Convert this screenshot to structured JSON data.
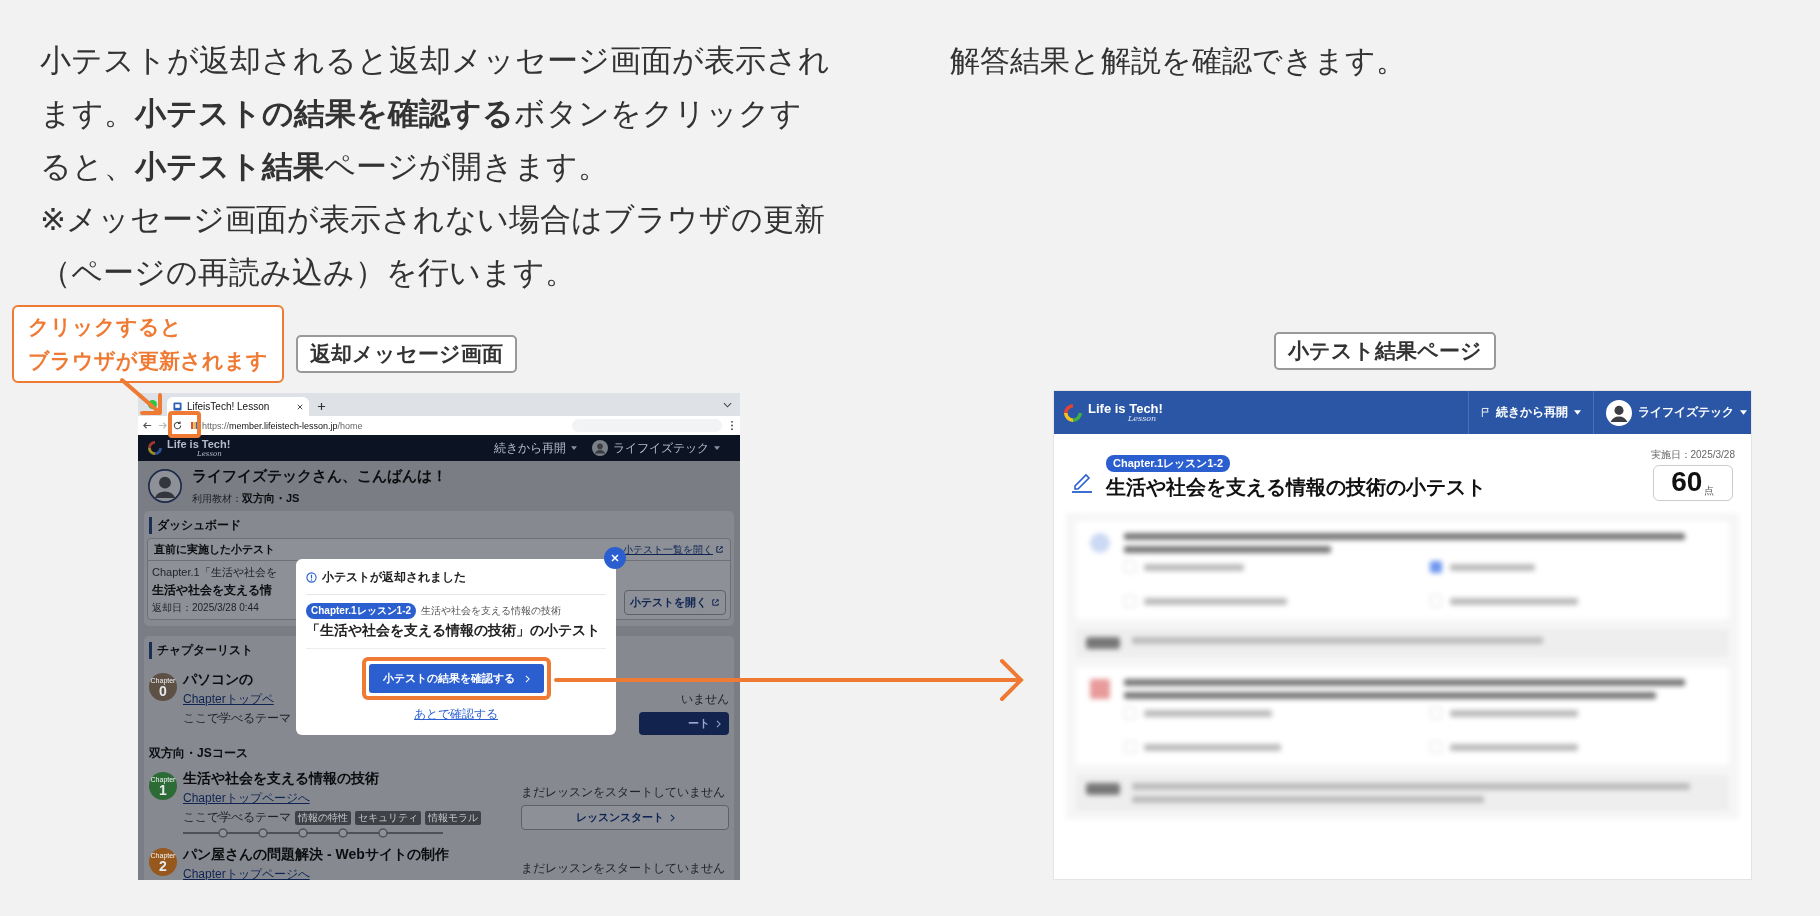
{
  "instructions": {
    "left": [
      "小テストが返却されると返却メッセージ画面が表示されます。**小テストの結果を確認する**ボタンをクリックすると、**小テスト結果**ページが開きます。",
      "※メッセージ画面が表示されない場合はブラウザの更新（ページの再読み込み）を行います。"
    ],
    "right": "解答結果と解説を確認できます。"
  },
  "callout": {
    "lines": [
      "クリックすると",
      "ブラウザが更新されます"
    ]
  },
  "captions": [
    "返却メッセージ画面",
    "小テスト結果ページ"
  ],
  "browser": {
    "tab_title": "LifeisTech! Lesson",
    "url": {
      "scheme": "https://",
      "host": "member.lifeistech-lesson.jp",
      "path": "/home"
    }
  },
  "home_page": {
    "logo": "Life is Tech!",
    "logo_sub": "Lesson",
    "resume": "続きから再開",
    "user": "ライフイズテック",
    "greeting": "ライフイズテックさん、こんばんは！",
    "material_label": "利用教材：",
    "material": "双方向・JS",
    "dashboard": {
      "title": "ダッシュボード",
      "recent_title": "直前に実施した小テスト",
      "list_link": "小テスト一覧を開く",
      "chapter_line": "Chapter.1「生活や社会を",
      "test_title": "生活や社会を支える情",
      "returned": "返却日：2025/3/28 0:44",
      "open_button": "小テストを開く"
    },
    "chapter_list": {
      "title": "チャプターリスト",
      "course": "双方向・JSコース",
      "chapters": [
        {
          "kind": "partial",
          "color": "#5d5045",
          "label": "Chapter",
          "number": "0",
          "title": "パソコンの",
          "link": "Chapterトップペ",
          "theme_label": "ここで学べるテーマ",
          "status": "いません",
          "button": "ート"
        },
        {
          "kind": "full",
          "color": "#2c6a36",
          "label": "Chapter",
          "number": "1",
          "title": "生活や社会を支える情報の技術",
          "link": "Chapterトップページへ",
          "theme_label": "ここで学べるテーマ",
          "themes": [
            "情報の特性",
            "セキュリティ",
            "情報モラル"
          ],
          "status": "まだレッスンをスタートしていません",
          "button": "レッスンスタート"
        },
        {
          "kind": "cut",
          "color": "#96581c",
          "label": "Chapter",
          "number": "2",
          "title": "パン屋さんの問題解決 - Webサイトの制作",
          "link": "Chapterトップページへ",
          "status": "まだレッスンをスタートしていません"
        }
      ]
    }
  },
  "modal": {
    "title": "小テストが返却されました",
    "badge": "Chapter.1レッスン1-2",
    "subtitle": "生活や社会を支える情報の技術",
    "heading": "「生活や社会を支える情報の技術」の小テスト",
    "confirm_button": "小テストの結果を確認する",
    "later_link": "あとで確認する"
  },
  "result_page": {
    "logo": "Life is Tech!",
    "logo_sub": "Lesson",
    "resume": "続きから再開",
    "user": "ライフイズテック",
    "badge": "Chapter.1レッスン1-2",
    "title": "生活や社会を支える情報の技術の小テスト",
    "date": "実施日：2025/3/28",
    "score": "60",
    "score_unit": "点"
  }
}
